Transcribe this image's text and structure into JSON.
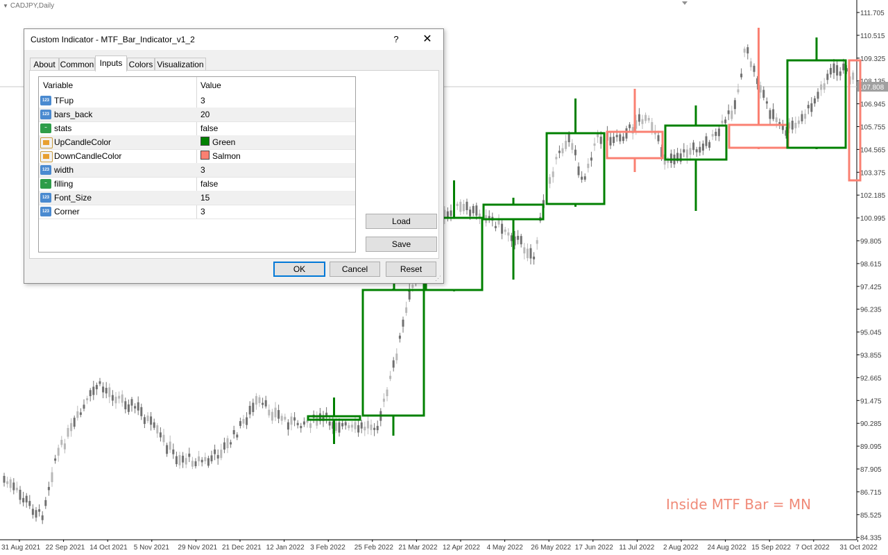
{
  "chart": {
    "title": "CADJPY,Daily",
    "current_price": "107.808",
    "overlay_label": "Inside MTF Bar = MN",
    "price_levels": [
      "111.705",
      "110.515",
      "109.325",
      "108.135",
      "106.945",
      "105.755",
      "104.565",
      "103.375",
      "102.185",
      "100.995",
      "99.805",
      "98.615",
      "97.425",
      "96.235",
      "95.045",
      "93.855",
      "92.665",
      "91.475",
      "90.285",
      "89.095",
      "87.905",
      "86.715",
      "85.525",
      "84.335"
    ],
    "date_labels": [
      "31 Aug 2021",
      "22 Sep 2021",
      "14 Oct 2021",
      "5 Nov 2021",
      "29 Nov 2021",
      "21 Dec 2021",
      "12 Jan 2022",
      "3 Feb 2022",
      "25 Feb 2022",
      "21 Mar 2022",
      "12 Apr 2022",
      "4 May 2022",
      "26 May 2022",
      "17 Jun 2022",
      "11 Jul 2022",
      "2 Aug 2022",
      "24 Aug 2022",
      "15 Sep 2022",
      "7 Oct 2022",
      "31 Oct 2022"
    ],
    "colors": {
      "up": "#008000",
      "down": "#fa8072",
      "candle_light": "#b8b8b8",
      "candle_dark": "#707070",
      "axis_text": "#404040"
    }
  },
  "dialog": {
    "title": "Custom Indicator - MTF_Bar_Indicator_v1_2",
    "help": "?",
    "close": "✕",
    "tabs": [
      "About",
      "Common",
      "Inputs",
      "Colors",
      "Visualization"
    ],
    "active_tab": "Inputs",
    "columns": {
      "variable": "Variable",
      "value": "Value"
    },
    "rows": [
      {
        "variable": "TFup",
        "value": "3",
        "type": "num"
      },
      {
        "variable": "bars_back",
        "value": "20",
        "type": "num"
      },
      {
        "variable": "stats",
        "value": "false",
        "type": "bool"
      },
      {
        "variable": "UpCandleColor",
        "value": "Green",
        "type": "color",
        "swatch": "#008000"
      },
      {
        "variable": "DownCandleColor",
        "value": "Salmon",
        "type": "color",
        "swatch": "#fa8072"
      },
      {
        "variable": "width",
        "value": "3",
        "type": "num"
      },
      {
        "variable": "filling",
        "value": "false",
        "type": "bool"
      },
      {
        "variable": "Font_Size",
        "value": "15",
        "type": "num"
      },
      {
        "variable": "Corner",
        "value": "3",
        "type": "num"
      }
    ],
    "buttons": {
      "load": "Load",
      "save": "Save",
      "ok": "OK",
      "cancel": "Cancel",
      "reset": "Reset"
    }
  }
}
